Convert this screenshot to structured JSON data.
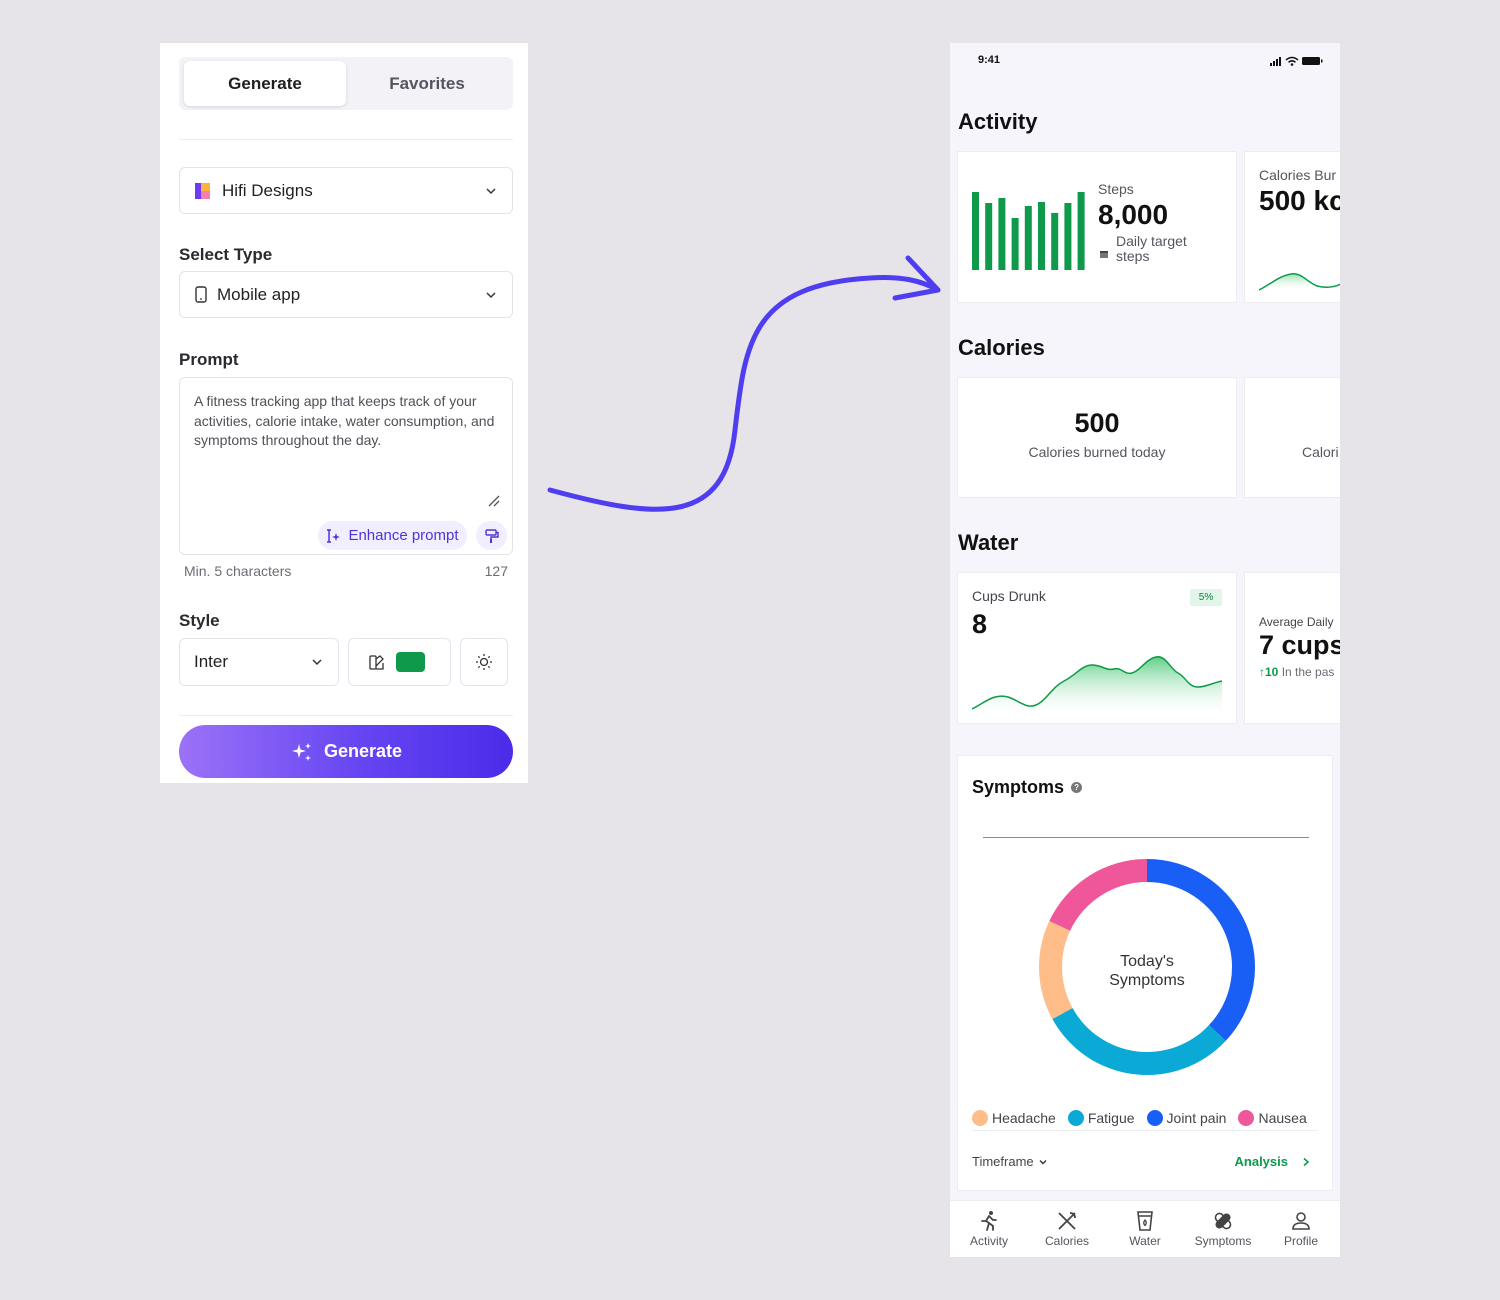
{
  "generator": {
    "tabs": [
      {
        "label": "Generate",
        "active": true
      },
      {
        "label": "Favorites",
        "active": false
      }
    ],
    "project": {
      "value": "Hifi Designs",
      "icon": "folder-icon"
    },
    "select_type": {
      "label": "Select Type",
      "value": "Mobile app",
      "icon": "phone-icon"
    },
    "prompt": {
      "label": "Prompt",
      "value": "A fitness tracking app that keeps track of your activities, calorie intake, water consumption, and symptoms throughout the day.",
      "enhance_label": "Enhance prompt",
      "hint": "Min. 5 characters",
      "count": "127"
    },
    "style": {
      "label": "Style",
      "font": "Inter",
      "color": "#0e9a4a"
    },
    "generate_label": "Generate"
  },
  "phone": {
    "status_time": "9:41",
    "sections": {
      "activity": "Activity",
      "calories": "Calories",
      "water": "Water"
    },
    "steps": {
      "label": "Steps",
      "value": "8,000",
      "target": "Daily target steps",
      "bars": [
        0.78,
        0.67,
        0.72,
        0.52,
        0.64,
        0.68,
        0.57,
        0.67,
        0.78
      ]
    },
    "calories_burned_peek": {
      "label": "Calories Bur",
      "value": "500 kc"
    },
    "calories_today": {
      "value": "500",
      "label": "Calories burned today"
    },
    "calories_peek": {
      "label": "Calori"
    },
    "cups": {
      "label": "Cups Drunk",
      "value": "8",
      "badge": "5%"
    },
    "avg_cups": {
      "label": "Average Daily",
      "value": "7 cups",
      "delta": "10",
      "delta_text": "In the pas"
    },
    "symptoms": {
      "title": "Symptoms",
      "center_line1": "Today's",
      "center_line2": "Symptoms",
      "segments": [
        {
          "name": "Joint pain",
          "value": 37,
          "color": "#1a5ff5"
        },
        {
          "name": "Fatigue",
          "value": 30,
          "color": "#0aa9d6"
        },
        {
          "name": "Headache",
          "value": 15,
          "color": "#ffbd8a"
        },
        {
          "name": "Nausea",
          "value": 18,
          "color": "#f0579a"
        }
      ],
      "legend": [
        {
          "name": "Headache",
          "color": "#ffbd8a"
        },
        {
          "name": "Fatigue",
          "color": "#0aa9d6"
        },
        {
          "name": "Joint pain",
          "color": "#1a5ff5"
        },
        {
          "name": "Nausea",
          "color": "#f0579a"
        }
      ],
      "timeframe": "Timeframe",
      "analysis": "Analysis"
    },
    "tabbar": [
      {
        "label": "Activity",
        "icon": "running-icon"
      },
      {
        "label": "Calories",
        "icon": "utensils-icon"
      },
      {
        "label": "Water",
        "icon": "water-glass-icon"
      },
      {
        "label": "Symptoms",
        "icon": "bandage-icon"
      },
      {
        "label": "Profile",
        "icon": "user-icon"
      }
    ]
  },
  "colors": {
    "accent": "#4b35d9",
    "green": "#0e9a4a",
    "arrow": "#4f3ef0"
  }
}
